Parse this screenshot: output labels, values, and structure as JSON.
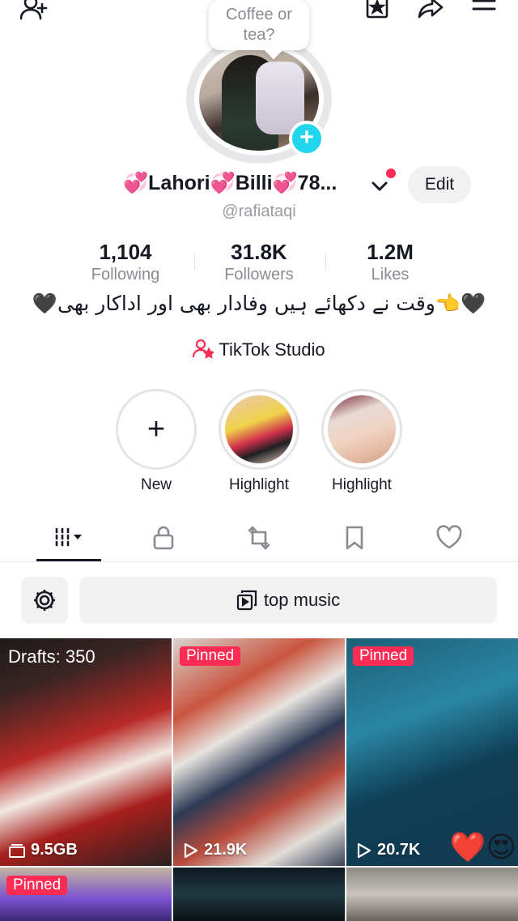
{
  "header": {
    "icons": [
      "add-friend-icon",
      "favorites-icon",
      "share-icon",
      "menu-icon"
    ]
  },
  "bubble": {
    "text": "Coffee or tea?"
  },
  "profile": {
    "name_parts": [
      "💞",
      "Lahori",
      "💞",
      "Billi",
      "💞",
      "78..."
    ],
    "handle": "@rafiataqi",
    "edit_label": "Edit"
  },
  "stats": [
    {
      "value": "1,104",
      "label": "Following"
    },
    {
      "value": "31.8K",
      "label": "Followers"
    },
    {
      "value": "1.2M",
      "label": "Likes"
    }
  ],
  "bio": "🖤👈وقت نے دکھائے ہیں وفادار بھی اور اداکار بھی🖤",
  "studio": {
    "label": "TikTok Studio"
  },
  "highlights": [
    {
      "label": "New"
    },
    {
      "label": "Highlight"
    },
    {
      "label": "Highlight"
    }
  ],
  "tabs": [
    "videos-grid",
    "private",
    "reposts",
    "favorites",
    "liked"
  ],
  "filter": {
    "music_label": "top music"
  },
  "videos": [
    {
      "top": "Drafts: 350",
      "meta": "9.5GB",
      "type": "drafts"
    },
    {
      "top": "Pinned",
      "meta": "21.9K",
      "type": "pinned"
    },
    {
      "top": "Pinned",
      "meta": "20.7K",
      "type": "pinned"
    },
    {
      "top": "Pinned",
      "meta": "",
      "type": "pinned"
    },
    {
      "top": "",
      "meta": "",
      "type": "video"
    },
    {
      "top": "",
      "meta": "",
      "type": "video"
    }
  ],
  "colors": {
    "accent": "#fe2c55",
    "teal": "#20d5ec",
    "muted": "#8a8b91"
  }
}
